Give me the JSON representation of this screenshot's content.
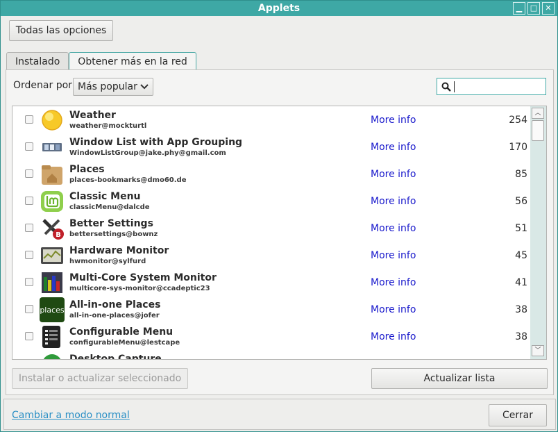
{
  "window": {
    "title": "Applets"
  },
  "toolbar": {
    "all_options": "Todas las opciones"
  },
  "tabs": [
    {
      "label": "Instalado",
      "active": false
    },
    {
      "label": "Obtener más en la red",
      "active": true
    }
  ],
  "sort": {
    "label": "Ordenar por",
    "selected": "Más popular"
  },
  "search": {
    "value": "",
    "placeholder": ""
  },
  "applets": [
    {
      "name": "Weather",
      "uuid": "weather@mockturtl",
      "more": "More info",
      "score": "254",
      "icon": "weather-sun-icon"
    },
    {
      "name": "Window List with App Grouping",
      "uuid": "WindowListGroup@jake.phy@gmail.com",
      "more": "More info",
      "score": "170",
      "icon": "window-list-icon"
    },
    {
      "name": "Places",
      "uuid": "places-bookmarks@dmo60.de",
      "more": "More info",
      "score": "85",
      "icon": "folder-home-icon"
    },
    {
      "name": "Classic Menu",
      "uuid": "classicMenu@dalcde",
      "more": "More info",
      "score": "56",
      "icon": "mint-logo-icon"
    },
    {
      "name": "Better Settings",
      "uuid": "bettersettings@bownz",
      "more": "More info",
      "score": "51",
      "icon": "tools-icon"
    },
    {
      "name": "Hardware Monitor",
      "uuid": "hwmonitor@sylfurd",
      "more": "More info",
      "score": "45",
      "icon": "monitor-graph-icon"
    },
    {
      "name": "Multi-Core System Monitor",
      "uuid": "multicore-sys-monitor@ccadeptic23",
      "more": "More info",
      "score": "41",
      "icon": "cpu-bars-icon"
    },
    {
      "name": "All-in-one Places",
      "uuid": "all-in-one-places@jofer",
      "more": "More info",
      "score": "38",
      "icon": "places-text-icon",
      "icon_text": "places"
    },
    {
      "name": "Configurable Menu",
      "uuid": "configurableMenu@lestcape",
      "more": "More info",
      "score": "38",
      "icon": "menu-list-icon"
    },
    {
      "name": "Desktop Capture",
      "uuid": "",
      "more": "",
      "score": "",
      "icon": "camera-icon"
    }
  ],
  "actions": {
    "install": "Instalar o actualizar seleccionado",
    "refresh": "Actualizar lista"
  },
  "footer": {
    "switch_mode": "Cambiar a modo normal",
    "close": "Cerrar"
  },
  "colors": {
    "accent": "#3ea8a5",
    "link": "#1a1acc"
  }
}
